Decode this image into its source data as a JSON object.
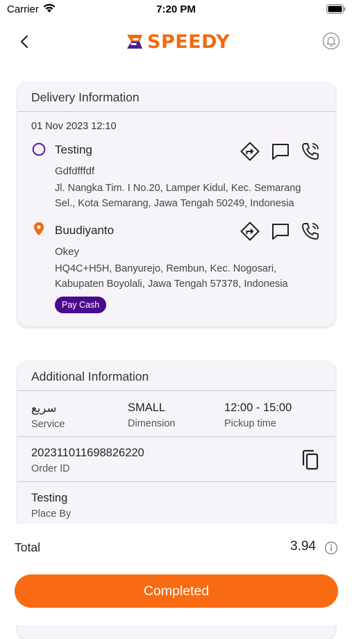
{
  "status_bar": {
    "carrier": "Carrier",
    "time": "7:20 PM"
  },
  "header": {
    "logo_text_part1": "SPEEDY"
  },
  "delivery": {
    "title": "Delivery Information",
    "date": "01 Nov 2023 12:10",
    "pickup": {
      "name": "Testing",
      "note": "Gdfdfffdf",
      "address": "Jl. Nangka Tim. I No.20, Lamper Kidul, Kec. Semarang Sel., Kota Semarang, Jawa Tengah 50249, Indonesia"
    },
    "dropoff": {
      "name": "Buudiyanto",
      "note": "Okey",
      "address": "HQ4C+H5H, Banyurejo, Rembun, Kec. Nogosari, Kabupaten Boyolali, Jawa Tengah 57378, Indonesia",
      "payment_badge": "Pay Cash"
    }
  },
  "additional": {
    "title": "Additional Information",
    "service_value": "سريع",
    "service_label": "Service",
    "dimension_value": "SMALL",
    "dimension_label": "Dimension",
    "pickup_time_value": "12:00 - 15:00",
    "pickup_time_label": "Pickup time",
    "order_id_value": "202311011698826220",
    "order_id_label": "Order ID",
    "place_by_value": "Testing",
    "place_by_label": "Place By"
  },
  "footer": {
    "total_label": "Total",
    "total_value": "3.94",
    "completed_label": "Completed"
  },
  "colors": {
    "brand_orange": "#f96b12",
    "brand_purple": "#4b0a8e",
    "card_bg": "#f6f3f9"
  }
}
